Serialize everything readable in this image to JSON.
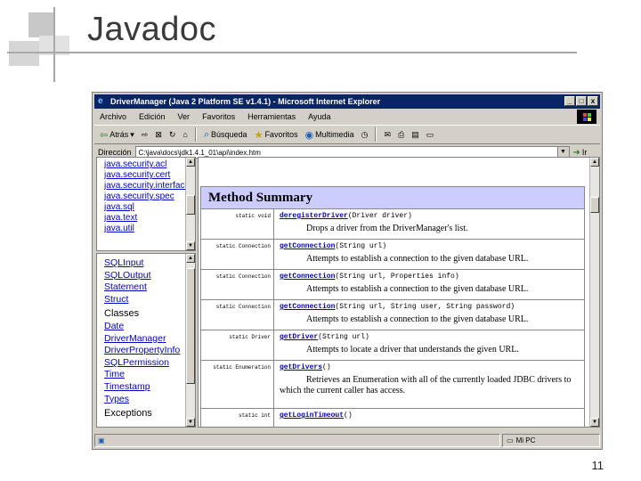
{
  "slide": {
    "title": "Javadoc",
    "page_number": "11"
  },
  "browser": {
    "window_title": "DriverManager (Java 2 Platform SE v1.4.1) - Microsoft Internet Explorer",
    "window_buttons": [
      "_",
      "□",
      "x"
    ],
    "menu": [
      "Archivo",
      "Edición",
      "Ver",
      "Favoritos",
      "Herramientas",
      "Ayuda"
    ],
    "toolbar": {
      "back": "Atrás",
      "search": "Búsqueda",
      "favorites": "Favoritos",
      "multimedia": "Multimedia"
    },
    "address": {
      "label": "Dirección",
      "value": "C:\\java\\docs\\jdk1.4.1_01\\api\\index.htm",
      "go": "Ir"
    },
    "status": {
      "text": "",
      "zone": "Mi PC"
    }
  },
  "packages": [
    "java.security.acl",
    "java.security.cert",
    "java.security.interfaces",
    "java.security.spec",
    "java.sql",
    "java.text",
    "java.util"
  ],
  "classes_frame": {
    "interfaces": [
      "SQLInput",
      "SQLOutput",
      "Statement",
      "Struct"
    ],
    "classes_heading": "Classes",
    "classes": [
      "Date",
      "DriverManager",
      "DriverPropertyInfo",
      "SQLPermission",
      "Time",
      "Timestamp",
      "Types"
    ],
    "exceptions_heading": "Exceptions"
  },
  "method_summary": {
    "heading": "Method Summary",
    "rows": [
      {
        "modifier": "static void",
        "method": "deregisterDriver",
        "params": "(Driver driver)",
        "description": "Drops a driver from the DriverManager's list."
      },
      {
        "modifier": "static Connection",
        "method": "getConnection",
        "params": "(String url)",
        "description": "Attempts to establish a connection to the given database URL."
      },
      {
        "modifier": "static Connection",
        "method": "getConnection",
        "params": "(String url, Properties info)",
        "description": "Attempts to establish a connection to the given database URL."
      },
      {
        "modifier": "static Connection",
        "method": "getConnection",
        "params": "(String url, String user, String password)",
        "description": "Attempts to establish a connection to the given database URL."
      },
      {
        "modifier": "static Driver",
        "method": "getDriver",
        "params": "(String url)",
        "description": "Attempts to locate a driver that understands the given URL."
      },
      {
        "modifier": "static Enumeration",
        "method": "getDrivers",
        "params": "()",
        "description": "Retrieves an Enumeration with all of the currently loaded JDBC drivers to which the current caller has access."
      },
      {
        "modifier": "static int",
        "method": "getLoginTimeout",
        "params": "()",
        "description": ""
      }
    ]
  }
}
